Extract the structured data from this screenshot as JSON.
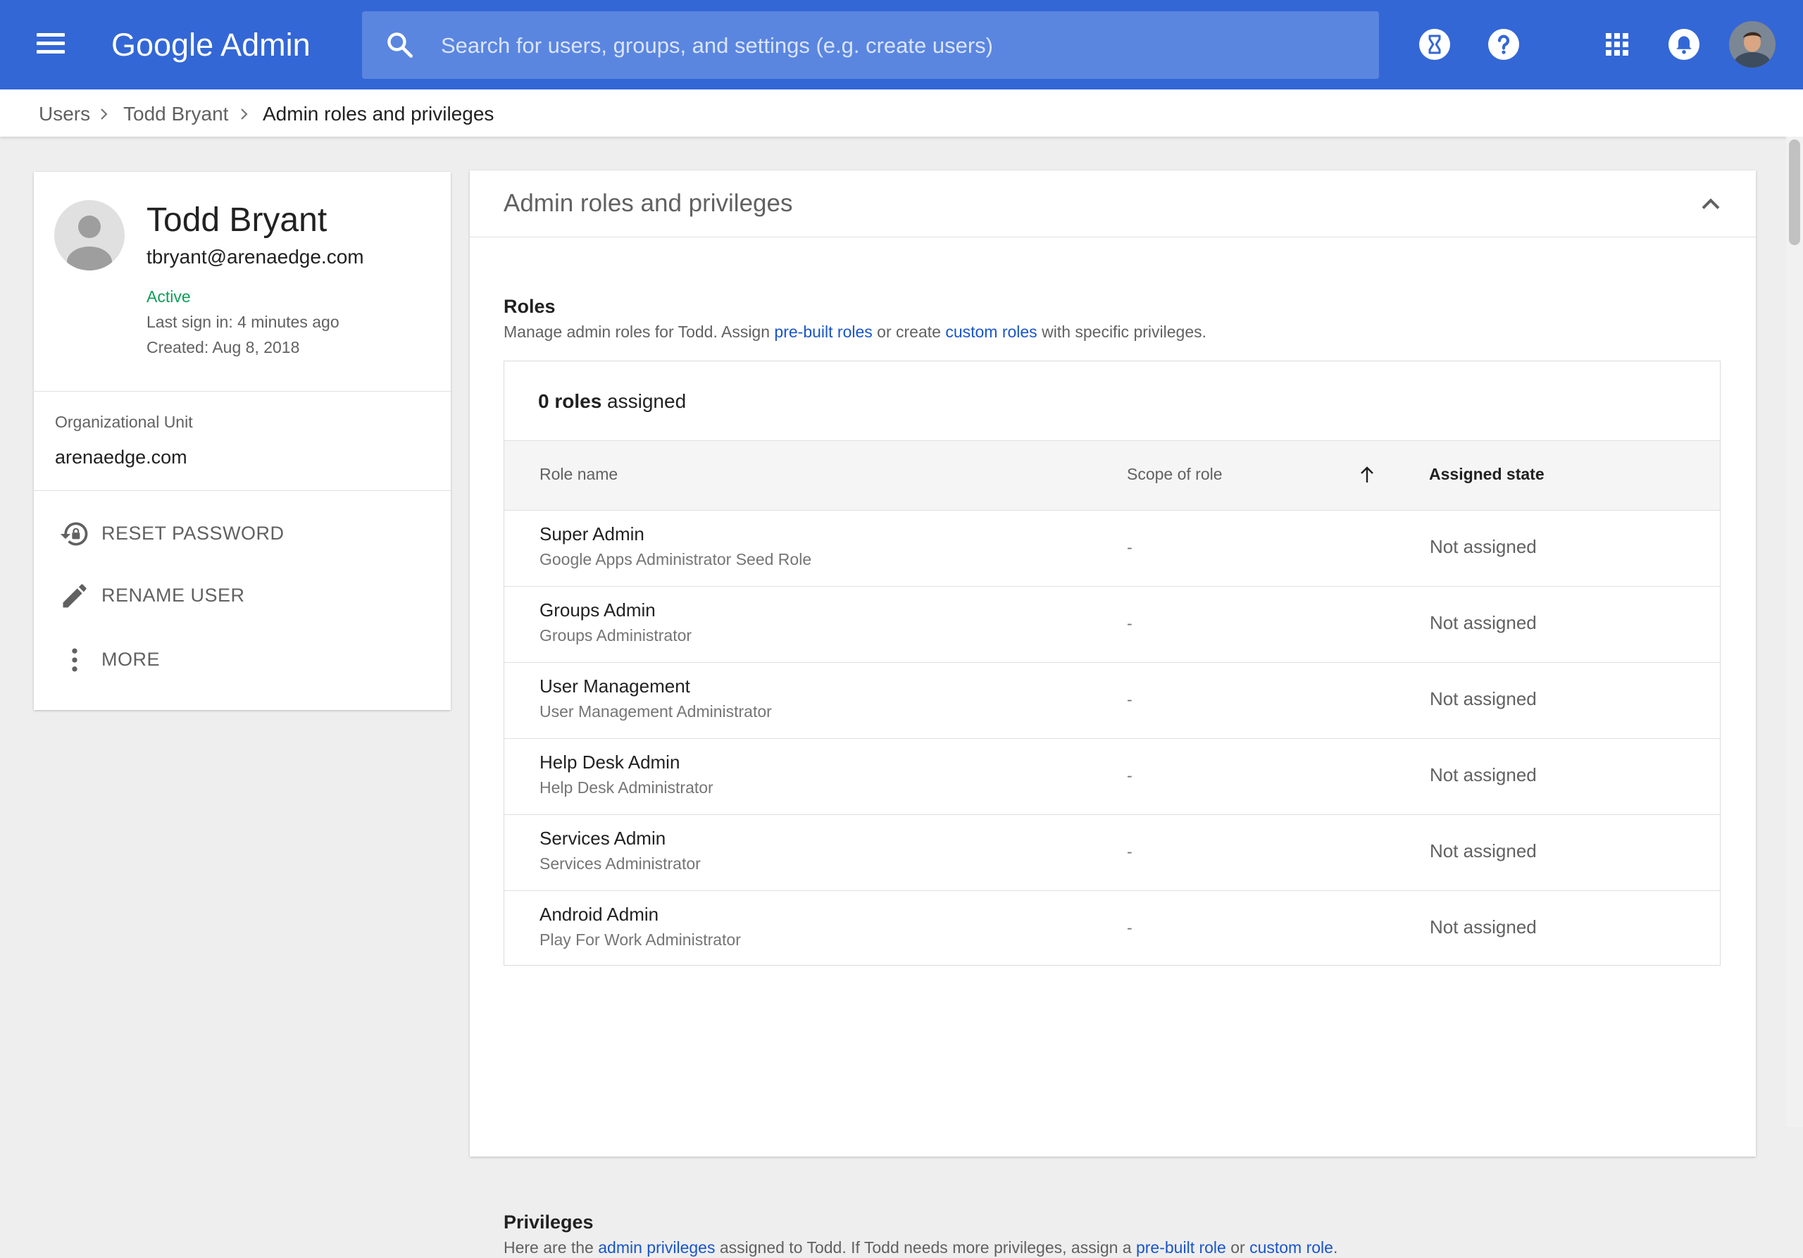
{
  "header": {
    "logo_google": "Google",
    "logo_admin": "Admin",
    "search_placeholder": "Search for users, groups, and settings (e.g. create users)",
    "icons": [
      "menu-icon",
      "search-icon",
      "hourglass-icon",
      "help-icon",
      "apps-grid-icon",
      "notifications-bell-icon",
      "account-avatar"
    ],
    "brand_color": "#3367d6"
  },
  "breadcrumb": [
    "Users",
    "Todd Bryant",
    "Admin roles and privileges"
  ],
  "user": {
    "name": "Todd Bryant",
    "email": "tbryant@arenaedge.com",
    "status": "Active",
    "last_sign_in": "Last sign in: 4 minutes ago",
    "created": "Created: Aug 8, 2018",
    "ou_label": "Organizational Unit",
    "ou_value": "arenaedge.com",
    "actions": [
      {
        "label": "RESET PASSWORD",
        "icon": "lock-reset-icon"
      },
      {
        "label": "RENAME USER",
        "icon": "pencil-icon"
      },
      {
        "label": "MORE",
        "icon": "more-vertical-icon"
      }
    ]
  },
  "panel": {
    "title": "Admin roles and privileges",
    "roles": {
      "title": "Roles",
      "desc_1": "Manage admin roles for Todd. Assign ",
      "link_1": "pre-built roles",
      "desc_2": " or create ",
      "link_2": "custom roles",
      "desc_3": " with specific privileges.",
      "count_bold": "0 roles",
      "count_rest": " assigned",
      "columns": [
        "Role name",
        "Scope of role",
        "Assigned state"
      ],
      "rows": [
        {
          "name": "Super Admin",
          "desc": "Google Apps Administrator Seed Role",
          "scope": "-",
          "state": "Not assigned"
        },
        {
          "name": "Groups Admin",
          "desc": "Groups Administrator",
          "scope": "-",
          "state": "Not assigned"
        },
        {
          "name": "User Management",
          "desc": "User Management Administrator",
          "scope": "-",
          "state": "Not assigned"
        },
        {
          "name": "Help Desk Admin",
          "desc": "Help Desk Administrator",
          "scope": "-",
          "state": "Not assigned"
        },
        {
          "name": "Services Admin",
          "desc": "Services Administrator",
          "scope": "-",
          "state": "Not assigned"
        },
        {
          "name": "Android Admin",
          "desc": "Play For Work Administrator",
          "scope": "-",
          "state": "Not assigned"
        }
      ]
    },
    "privileges": {
      "title": "Privileges",
      "desc_1": "Here are the ",
      "link_1": "admin privileges",
      "desc_2": " assigned to Todd. If Todd needs more privileges, assign a ",
      "link_2": "pre-built role",
      "desc_3": " or ",
      "link_3": "custom role",
      "desc_4": "."
    }
  }
}
